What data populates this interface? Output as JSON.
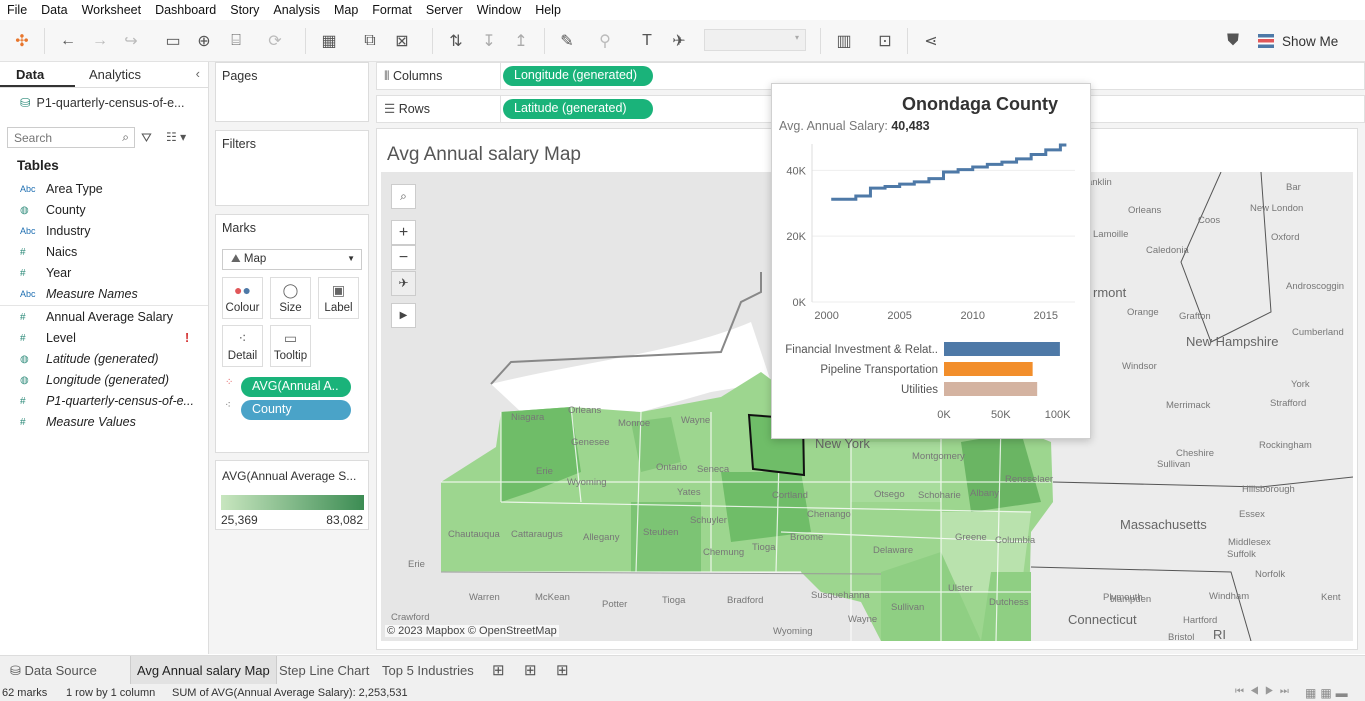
{
  "menu": [
    "File",
    "Data",
    "Worksheet",
    "Dashboard",
    "Story",
    "Analysis",
    "Map",
    "Format",
    "Server",
    "Window",
    "Help"
  ],
  "toolbar": {
    "show_me": "Show Me"
  },
  "left_pane": {
    "tabs": [
      "Data",
      "Analytics"
    ],
    "datasource": "P1-quarterly-census-of-e...",
    "search_placeholder": "Search",
    "tables_heading": "Tables",
    "fields": [
      {
        "name": "Area Type",
        "type": "Abc",
        "italic": false
      },
      {
        "name": "County",
        "type": "globe",
        "italic": false
      },
      {
        "name": "Industry",
        "type": "Abc",
        "italic": false
      },
      {
        "name": "Naics",
        "type": "#",
        "italic": false
      },
      {
        "name": "Year",
        "type": "#",
        "italic": false
      },
      {
        "name": "Measure Names",
        "type": "Abc",
        "italic": true
      },
      {
        "name": "Annual Average Salary",
        "type": "#",
        "italic": false
      },
      {
        "name": "Level",
        "type": "#",
        "italic": false,
        "warning": "!"
      },
      {
        "name": "Latitude (generated)",
        "type": "globe",
        "italic": true
      },
      {
        "name": "Longitude (generated)",
        "type": "globe",
        "italic": true
      },
      {
        "name": "P1-quarterly-census-of-e...",
        "type": "#",
        "italic": true
      },
      {
        "name": "Measure Values",
        "type": "#",
        "italic": true
      }
    ]
  },
  "cards": {
    "pages": "Pages",
    "filters": "Filters",
    "marks": "Marks",
    "mark_type": "Map",
    "mark_buttons": [
      "Colour",
      "Size",
      "Label",
      "Detail",
      "Tooltip"
    ],
    "pills": [
      "AVG(Annual A..",
      "County"
    ],
    "legend_title": "AVG(Annual Average S...",
    "legend_min": "25,369",
    "legend_max": "83,082"
  },
  "shelves": {
    "columns_label": "Columns",
    "columns_pill": "Longitude (generated)",
    "rows_label": "Rows",
    "rows_pill": "Latitude (generated)"
  },
  "sheet_title": "Avg Annual salary Map",
  "map": {
    "attribution": "© 2023 Mapbox © OpenStreetMap",
    "labels": [
      "Niagara",
      "Orleans",
      "Monroe",
      "Wayne",
      "Genesee",
      "Erie",
      "Wyoming",
      "Ontario",
      "Seneca",
      "Yates",
      "Chautauqua",
      "Cattaraugus",
      "Allegany",
      "Steuben",
      "Schuyler",
      "Chemung",
      "Tioga",
      "Broome",
      "Cortland",
      "Chenango",
      "Otsego",
      "Delaware",
      "Schoharie",
      "Albany",
      "Greene",
      "Columbia",
      "Rensselaer",
      "Ulster",
      "Dutchess",
      "Sullivan",
      "Montgomery",
      "Warren",
      "McKean",
      "Potter",
      "Tioga",
      "Bradford",
      "Susquehanna",
      "Wayne",
      "Wyoming",
      "Crawford",
      "Erie",
      "Franklin",
      "Orleans",
      "Lamoille",
      "Caledonia",
      "Orange",
      "Windsor",
      "Grafton",
      "Coos",
      "Oxford",
      "Androscoggin",
      "Cumberland",
      "York",
      "Strafford",
      "Rockingham",
      "Merrimack",
      "Sullivan",
      "Cheshire",
      "Hillsborough",
      "Essex",
      "Middlesex",
      "Suffolk",
      "Norfolk",
      "Plymouth",
      "Hampden",
      "Hartford",
      "Windham",
      "Bristol",
      "Kent",
      "New London",
      "Bar",
      "Franklin",
      "Worcester"
    ],
    "big_labels": [
      "rmont",
      "New Hampshire",
      "Massachusetts",
      "Connecticut",
      "RI",
      "New York"
    ]
  },
  "tooltip": {
    "county": "Onondaga County",
    "salary_label": "Avg. Annual Salary:",
    "salary_value": "40,483",
    "y_ticks": [
      "40K",
      "20K",
      "0K"
    ],
    "x_ticks": [
      "2000",
      "2005",
      "2010",
      "2015"
    ],
    "industries": [
      {
        "name": "Financial Investment & Relat..",
        "value": 102000,
        "color": "#4e79a7"
      },
      {
        "name": "Pipeline Transportation",
        "value": 78000,
        "color": "#f28e2b"
      },
      {
        "name": "Utilities",
        "value": 82000,
        "color": "#d4b3a1"
      }
    ],
    "bar_ticks": [
      "0K",
      "50K",
      "100K"
    ]
  },
  "chart_data": {
    "type": "line",
    "x": [
      2001,
      2002,
      2003,
      2004,
      2005,
      2006,
      2007,
      2008,
      2009,
      2010,
      2011,
      2012,
      2013,
      2014,
      2015,
      2016
    ],
    "values": [
      31200,
      32200,
      34600,
      35100,
      35800,
      36500,
      37500,
      39500,
      40200,
      41000,
      41800,
      42500,
      43500,
      44800,
      46200,
      47700
    ],
    "ylim": [
      0,
      48000
    ],
    "xlim": [
      1999,
      2017
    ]
  },
  "bar_data": {
    "type": "bar",
    "categories": [
      "Financial Investment & Relat..",
      "Pipeline Transportation",
      "Utilities"
    ],
    "values": [
      102000,
      78000,
      82000
    ],
    "xlim": [
      0,
      110000
    ]
  },
  "sheet_tabs": {
    "data_source": "Data Source",
    "tabs": [
      "Avg Annual salary Map",
      "Step Line Chart",
      "Top 5 Industries"
    ]
  },
  "status": {
    "marks": "62 marks",
    "rowcol": "1 row by 1 column",
    "sum": "SUM of AVG(Annual Average Salary): 2,253,531"
  }
}
